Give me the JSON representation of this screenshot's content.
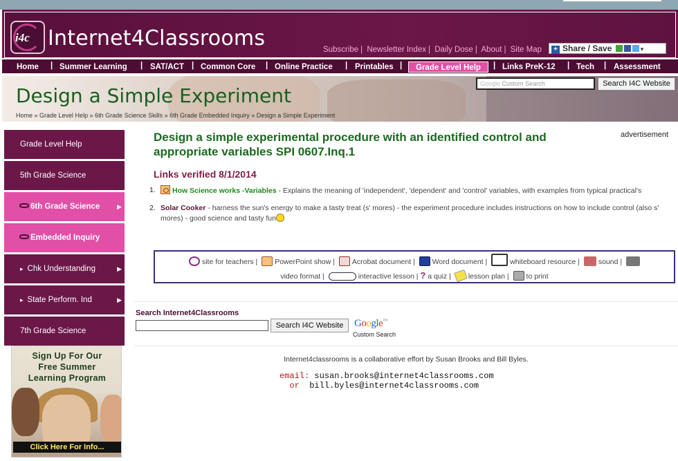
{
  "header": {
    "brand": "Internet4Classrooms",
    "logo_text": "i4c",
    "top_links": [
      "Subscribe",
      "Newsletter Index",
      "Daily Dose",
      "About",
      "Site Map"
    ],
    "share_label": "Share / Save"
  },
  "nav": {
    "items": [
      "Home",
      "Summer Learning",
      "SAT/ACT",
      "Common Core",
      "Online Practice",
      "Printables",
      "Grade Level Help",
      "Links PreK-12",
      "Tech",
      "Assessment"
    ],
    "active": "Grade Level Help"
  },
  "banner": {
    "title": "Design a Simple Experiment",
    "search_placeholder": "Custom Search",
    "search_button": "Search I4C Website",
    "breadcrumb": [
      "Home",
      "Grade Level Help",
      "6th Grade Science Skills",
      "6th Grade Embedded Inquiry",
      "Design a Simple Experiment"
    ]
  },
  "sidebar": {
    "items": [
      {
        "label": "Grade Level Help",
        "style": "dark"
      },
      {
        "label": "5th Grade Science",
        "style": "dark"
      },
      {
        "label": "6th Grade Science",
        "style": "pink"
      },
      {
        "label": "Embedded Inquiry",
        "style": "pink"
      },
      {
        "label": "Chk Understanding",
        "style": "dark"
      },
      {
        "label": "State Perform. Ind",
        "style": "dark"
      },
      {
        "label": "7th Grade Science",
        "style": "dark"
      }
    ],
    "promo": {
      "lines": [
        "Sign Up For Our",
        "Free Summer",
        "Learning Program"
      ],
      "cta": "Click Here For Info..."
    }
  },
  "main": {
    "title": "Design a simple experimental procedure with an identified control and appropriate variables SPI 0607.Inq.1",
    "advertisement": "advertisement",
    "verified": "Links verified 8/1/2014",
    "resources": [
      {
        "num": "1.",
        "link": "How Science works -Variables",
        "desc": " - Explains the meaning of 'independent', 'dependent' and 'control' variables, with examples from typical practical's"
      },
      {
        "num": "2.",
        "link": "Solar Cooker",
        "desc": " - harness the sun's energy to make a tasty treat (s' mores) - the experiment procedure includes instructions on how to include control (also s' mores) - good science and tasty fun"
      }
    ],
    "legend": {
      "site_teachers": "site for teachers",
      "powerpoint": "PowerPoint show",
      "acrobat": "Acrobat document",
      "word": "Word document",
      "whiteboard": "whiteboard resource",
      "sound": "sound",
      "video": "video format",
      "interactive": "interactive lesson",
      "quiz": "a quiz",
      "lesson_plan": "lesson plan",
      "print": "to print"
    }
  },
  "search": {
    "label": "Search Internet4Classrooms",
    "button": "Search I4C Website",
    "google": "Google",
    "google_sub": "Custom Search"
  },
  "footer": {
    "collab": "Internet4classrooms is a collaborative effort by Susan Brooks and Bill Byles.",
    "email_label": "email:",
    "email1": "susan.brooks@internet4classrooms.com",
    "or_label": "or",
    "email2": "bill.byles@internet4classrooms.com"
  },
  "colors": {
    "brand_dark": "#6b1747",
    "brand_pink": "#e14fa6",
    "title_green": "#1b6a20",
    "link_green": "#1b8a1b"
  }
}
